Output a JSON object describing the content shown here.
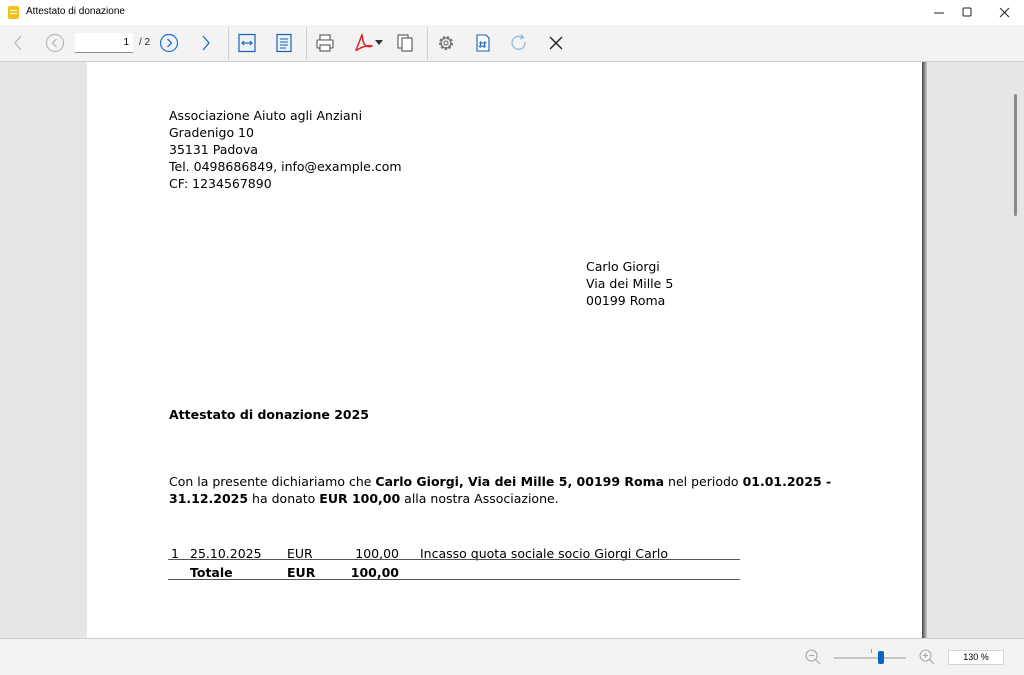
{
  "window": {
    "title": "Attestato di donazione",
    "minimize_glyph": "—",
    "maximize_glyph": "☐",
    "close_glyph": "✕"
  },
  "toolbar": {
    "page_current": "1",
    "page_total": "/ 2",
    "icons": [
      "back-icon",
      "previous-page-icon",
      "next-page-icon",
      "forward-icon",
      "fit-width-icon",
      "fit-page-icon",
      "print-icon",
      "pdf-export-icon",
      "copy-icon",
      "settings-icon",
      "page-number-icon",
      "refresh-icon",
      "close-icon"
    ]
  },
  "document": {
    "sender": {
      "line1": "Associazione Aiuto agli Anziani",
      "line2": "Gradenigo 10",
      "line3": "35131 Padova",
      "line4": "Tel. 0498686849, info@example.com",
      "line5": "CF: 1234567890"
    },
    "recipient": {
      "name": "Carlo Giorgi",
      "street": "Via dei Mille 5",
      "city": "00199 Roma"
    },
    "title": "Attestato di donazione 2025",
    "body": {
      "part1": "Con la presente dichiariamo che ",
      "donor": "Carlo Giorgi, Via dei Mille 5, 00199 Roma",
      "part2": " nel periodo ",
      "period": "01.01.2025 - 31.12.2025",
      "part3": " ha donato ",
      "amount": "EUR 100,00",
      "part4": " alla nostra Associazione."
    },
    "table": {
      "rows": [
        {
          "num": "1",
          "date": "25.10.2025",
          "currency": "EUR",
          "amount": "100,00",
          "description": "Incasso quota sociale socio Giorgi Carlo"
        }
      ],
      "total": {
        "label": "Totale",
        "currency": "EUR",
        "amount": "100,00"
      }
    }
  },
  "statusbar": {
    "zoom": "130 %",
    "zoom_level_fraction": 0.65
  },
  "colors": {
    "accent": "#0a64c8",
    "pdf_red": "#d9262c",
    "app_icon": "#f3c21a"
  }
}
